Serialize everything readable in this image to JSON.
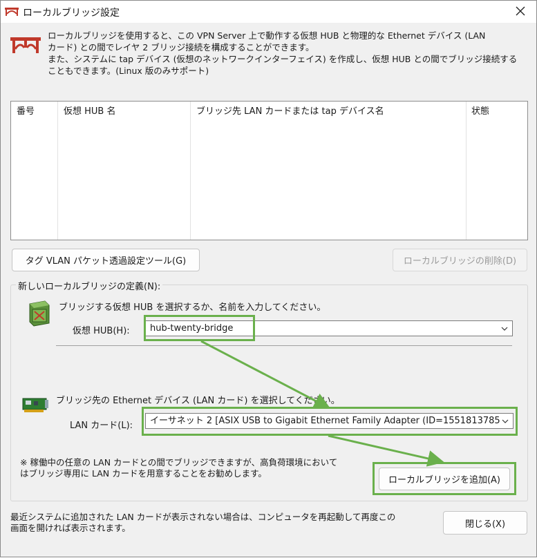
{
  "window": {
    "title": "ローカルブリッジ設定",
    "icon": "bridge-icon",
    "close_icon": "close-icon"
  },
  "intro": {
    "text": "ローカルブリッジを使用すると、この VPN Server 上で動作する仮想 HUB と物理的な Ethernet デバイス (LAN\nカード) との間でレイヤ 2 ブリッジ接続を構成することができます。\nまた、システムに tap デバイス (仮想のネットワークインターフェイス) を作成し、仮想 HUB との間でブリッジ接続する\nこともできます。(Linux 版のみサポート)"
  },
  "table": {
    "columns": [
      "番号",
      "仮想 HUB 名",
      "ブリッジ先 LAN カードまたは tap デバイス名",
      "状態"
    ],
    "rows": []
  },
  "buttons": {
    "vlan_tool": "タグ VLAN パケット透過設定ツール(G)",
    "delete_bridge": "ローカルブリッジの削除(D)",
    "add_bridge": "ローカルブリッジを追加(A)",
    "close": "閉じる(X)"
  },
  "new_bridge": {
    "group_label": "新しいローカルブリッジの定義(N):",
    "hub_prompt": "ブリッジする仮想 HUB を選択するか、名前を入力してください。",
    "hub_label": "仮想 HUB(H):",
    "hub_value": "hub-twenty-bridge",
    "lan_prompt": "ブリッジ先の Ethernet デバイス (LAN カード) を選択してください。",
    "lan_label": "LAN カード(L):",
    "lan_value": "イーサネット 2 [ASIX USB to Gigabit Ethernet Family Adapter (ID=1551813785)",
    "note": "※ 稼働中の任意の LAN カードとの間でブリッジできますが、高負荷環境において\nはブリッジ専用に LAN カードを用意することをお勧めします。"
  },
  "footer": {
    "text": "最近システムに追加された LAN カードが表示されない場合は、コンピュータを再起動して再度この\n画面を開ければ表示されます。"
  },
  "colors": {
    "highlight": "#6ab04c",
    "window_bg": "#f0f0f0"
  }
}
